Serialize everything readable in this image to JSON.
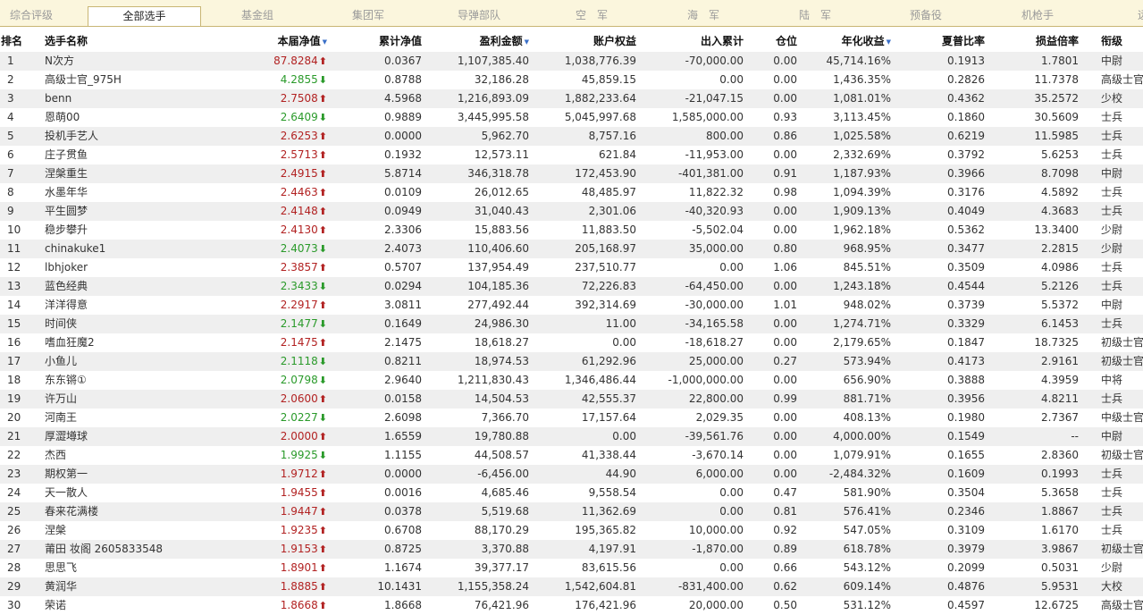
{
  "tabs": [
    {
      "label": "综合评级",
      "active": false
    },
    {
      "label": "全部选手",
      "active": true
    },
    {
      "label": "基金组",
      "active": false
    },
    {
      "label": "集团军",
      "active": false
    },
    {
      "label": "导弹部队",
      "active": false
    },
    {
      "label": "空　军",
      "active": false
    },
    {
      "label": "海　军",
      "active": false
    },
    {
      "label": "陆　军",
      "active": false
    },
    {
      "label": "预备役",
      "active": false
    },
    {
      "label": "机枪手",
      "active": false
    },
    {
      "label": "远",
      "active": false
    }
  ],
  "columns": {
    "rank": "排名",
    "name": "选手名称",
    "net": "本届净值",
    "cum_net": "累计净值",
    "pl": "盈利金额",
    "equity": "账户权益",
    "inout": "出入累计",
    "position": "仓位",
    "annual": "年化收益",
    "sharpe": "夏普比率",
    "profit_ratio": "损益倍率",
    "military_rank": "衔级"
  },
  "sorted_columns": [
    "net",
    "pl",
    "annual"
  ],
  "colors": {
    "up": "#b22222",
    "down": "#2a9a2a",
    "accent": "#c8b674",
    "tab_bg": "#fbf6dd",
    "row_alt": "#efefef"
  },
  "icons": {
    "up": "arrow-up-icon",
    "down": "arrow-down-icon",
    "sort": "sort-desc-icon"
  },
  "rows": [
    {
      "rank": "1",
      "name": "N次方",
      "net": "87.8284",
      "dir": "up",
      "cum": "0.0367",
      "pl": "1,107,385.40",
      "eq": "1,038,776.39",
      "io": "-70,000.00",
      "pos": "0.00",
      "ann": "45,714.16%",
      "sh": "0.1913",
      "pr": "1.7801",
      "rk": "中尉"
    },
    {
      "rank": "2",
      "name": "高级士官_975H",
      "net": "4.2855",
      "dir": "down",
      "cum": "0.8788",
      "pl": "32,186.28",
      "eq": "45,859.15",
      "io": "0.00",
      "pos": "0.00",
      "ann": "1,436.35%",
      "sh": "0.2826",
      "pr": "11.7378",
      "rk": "高级士官"
    },
    {
      "rank": "3",
      "name": "benn",
      "net": "2.7508",
      "dir": "up",
      "cum": "4.5968",
      "pl": "1,216,893.09",
      "eq": "1,882,233.64",
      "io": "-21,047.15",
      "pos": "0.00",
      "ann": "1,081.01%",
      "sh": "0.4362",
      "pr": "35.2572",
      "rk": "少校"
    },
    {
      "rank": "4",
      "name": "恩萌00",
      "net": "2.6409",
      "dir": "down",
      "cum": "0.9889",
      "pl": "3,445,995.58",
      "eq": "5,045,997.68",
      "io": "1,585,000.00",
      "pos": "0.93",
      "ann": "3,113.45%",
      "sh": "0.1860",
      "pr": "30.5609",
      "rk": "士兵"
    },
    {
      "rank": "5",
      "name": "投机手艺人",
      "net": "2.6253",
      "dir": "up",
      "cum": "0.0000",
      "pl": "5,962.70",
      "eq": "8,757.16",
      "io": "800.00",
      "pos": "0.86",
      "ann": "1,025.58%",
      "sh": "0.6219",
      "pr": "11.5985",
      "rk": "士兵"
    },
    {
      "rank": "6",
      "name": "庄子贯鱼",
      "net": "2.5713",
      "dir": "up",
      "cum": "0.1932",
      "pl": "12,573.11",
      "eq": "621.84",
      "io": "-11,953.00",
      "pos": "0.00",
      "ann": "2,332.69%",
      "sh": "0.3792",
      "pr": "5.6253",
      "rk": "士兵"
    },
    {
      "rank": "7",
      "name": "涅槃重生",
      "net": "2.4915",
      "dir": "up",
      "cum": "5.8714",
      "pl": "346,318.78",
      "eq": "172,453.90",
      "io": "-401,381.00",
      "pos": "0.91",
      "ann": "1,187.93%",
      "sh": "0.3966",
      "pr": "8.7098",
      "rk": "中尉"
    },
    {
      "rank": "8",
      "name": "水墨年华",
      "net": "2.4463",
      "dir": "up",
      "cum": "0.0109",
      "pl": "26,012.65",
      "eq": "48,485.97",
      "io": "11,822.32",
      "pos": "0.98",
      "ann": "1,094.39%",
      "sh": "0.3176",
      "pr": "4.5892",
      "rk": "士兵"
    },
    {
      "rank": "9",
      "name": "平生圆梦",
      "net": "2.4148",
      "dir": "up",
      "cum": "0.0949",
      "pl": "31,040.43",
      "eq": "2,301.06",
      "io": "-40,320.93",
      "pos": "0.00",
      "ann": "1,909.13%",
      "sh": "0.4049",
      "pr": "4.3683",
      "rk": "士兵"
    },
    {
      "rank": "10",
      "name": "稳步攀升",
      "net": "2.4130",
      "dir": "up",
      "cum": "2.3306",
      "pl": "15,883.56",
      "eq": "11,883.50",
      "io": "-5,502.04",
      "pos": "0.00",
      "ann": "1,962.18%",
      "sh": "0.5362",
      "pr": "13.3400",
      "rk": "少尉"
    },
    {
      "rank": "11",
      "name": "chinakuke1",
      "net": "2.4073",
      "dir": "down",
      "cum": "2.4073",
      "pl": "110,406.60",
      "eq": "205,168.97",
      "io": "35,000.00",
      "pos": "0.80",
      "ann": "968.95%",
      "sh": "0.3477",
      "pr": "2.2815",
      "rk": "少尉"
    },
    {
      "rank": "12",
      "name": "lbhjoker",
      "net": "2.3857",
      "dir": "up",
      "cum": "0.5707",
      "pl": "137,954.49",
      "eq": "237,510.77",
      "io": "0.00",
      "pos": "1.06",
      "ann": "845.51%",
      "sh": "0.3509",
      "pr": "4.0986",
      "rk": "士兵"
    },
    {
      "rank": "13",
      "name": "蓝色经典",
      "net": "2.3433",
      "dir": "down",
      "cum": "0.0294",
      "pl": "104,185.36",
      "eq": "72,226.83",
      "io": "-64,450.00",
      "pos": "0.00",
      "ann": "1,243.18%",
      "sh": "0.4544",
      "pr": "5.2126",
      "rk": "士兵"
    },
    {
      "rank": "14",
      "name": "洋洋得意",
      "net": "2.2917",
      "dir": "up",
      "cum": "3.0811",
      "pl": "277,492.44",
      "eq": "392,314.69",
      "io": "-30,000.00",
      "pos": "1.01",
      "ann": "948.02%",
      "sh": "0.3739",
      "pr": "5.5372",
      "rk": "中尉"
    },
    {
      "rank": "15",
      "name": "时间侠",
      "net": "2.1477",
      "dir": "down",
      "cum": "0.1649",
      "pl": "24,986.30",
      "eq": "11.00",
      "io": "-34,165.58",
      "pos": "0.00",
      "ann": "1,274.71%",
      "sh": "0.3329",
      "pr": "6.1453",
      "rk": "士兵"
    },
    {
      "rank": "16",
      "name": "嗜血狂魔2",
      "net": "2.1475",
      "dir": "up",
      "cum": "2.1475",
      "pl": "18,618.27",
      "eq": "0.00",
      "io": "-18,618.27",
      "pos": "0.00",
      "ann": "2,179.65%",
      "sh": "0.1847",
      "pr": "18.7325",
      "rk": "初级士官"
    },
    {
      "rank": "17",
      "name": "小鱼儿",
      "net": "2.1118",
      "dir": "down",
      "cum": "0.8211",
      "pl": "18,974.53",
      "eq": "61,292.96",
      "io": "25,000.00",
      "pos": "0.27",
      "ann": "573.94%",
      "sh": "0.4173",
      "pr": "2.9161",
      "rk": "初级士官"
    },
    {
      "rank": "18",
      "name": "东东锵①",
      "net": "2.0798",
      "dir": "down",
      "cum": "2.9640",
      "pl": "1,211,830.43",
      "eq": "1,346,486.44",
      "io": "-1,000,000.00",
      "pos": "0.00",
      "ann": "656.90%",
      "sh": "0.3888",
      "pr": "4.3959",
      "rk": "中将"
    },
    {
      "rank": "19",
      "name": "许万山",
      "net": "2.0600",
      "dir": "up",
      "cum": "0.0158",
      "pl": "14,504.53",
      "eq": "42,555.37",
      "io": "22,800.00",
      "pos": "0.99",
      "ann": "881.71%",
      "sh": "0.3956",
      "pr": "4.8211",
      "rk": "士兵"
    },
    {
      "rank": "20",
      "name": "河南王",
      "net": "2.0227",
      "dir": "down",
      "cum": "2.6098",
      "pl": "7,366.70",
      "eq": "17,157.64",
      "io": "2,029.35",
      "pos": "0.00",
      "ann": "408.13%",
      "sh": "0.1980",
      "pr": "2.7367",
      "rk": "中级士官"
    },
    {
      "rank": "21",
      "name": "厚澀墫球",
      "net": "2.0000",
      "dir": "up",
      "cum": "1.6559",
      "pl": "19,780.88",
      "eq": "0.00",
      "io": "-39,561.76",
      "pos": "0.00",
      "ann": "4,000.00%",
      "sh": "0.1549",
      "pr": "--",
      "rk": "中尉"
    },
    {
      "rank": "22",
      "name": "杰西",
      "net": "1.9925",
      "dir": "down",
      "cum": "1.1155",
      "pl": "44,508.57",
      "eq": "41,338.44",
      "io": "-3,670.14",
      "pos": "0.00",
      "ann": "1,079.91%",
      "sh": "0.1655",
      "pr": "2.8360",
      "rk": "初级士官"
    },
    {
      "rank": "23",
      "name": "期权第一",
      "net": "1.9712",
      "dir": "up",
      "cum": "0.0000",
      "pl": "-6,456.00",
      "eq": "44.90",
      "io": "6,000.00",
      "pos": "0.00",
      "ann": "-2,484.32%",
      "sh": "0.1609",
      "pr": "0.1993",
      "rk": "士兵"
    },
    {
      "rank": "24",
      "name": "天一散人",
      "net": "1.9455",
      "dir": "up",
      "cum": "0.0016",
      "pl": "4,685.46",
      "eq": "9,558.54",
      "io": "0.00",
      "pos": "0.47",
      "ann": "581.90%",
      "sh": "0.3504",
      "pr": "5.3658",
      "rk": "士兵"
    },
    {
      "rank": "25",
      "name": "春来花满楼",
      "net": "1.9447",
      "dir": "up",
      "cum": "0.0378",
      "pl": "5,519.68",
      "eq": "11,362.69",
      "io": "0.00",
      "pos": "0.81",
      "ann": "576.41%",
      "sh": "0.2346",
      "pr": "1.8867",
      "rk": "士兵"
    },
    {
      "rank": "26",
      "name": "涅槃",
      "net": "1.9235",
      "dir": "up",
      "cum": "0.6708",
      "pl": "88,170.29",
      "eq": "195,365.82",
      "io": "10,000.00",
      "pos": "0.92",
      "ann": "547.05%",
      "sh": "0.3109",
      "pr": "1.6170",
      "rk": "士兵"
    },
    {
      "rank": "27",
      "name": "莆田 妆阁 2605833548",
      "net": "1.9153",
      "dir": "up",
      "cum": "0.8725",
      "pl": "3,370.88",
      "eq": "4,197.91",
      "io": "-1,870.00",
      "pos": "0.89",
      "ann": "618.78%",
      "sh": "0.3979",
      "pr": "3.9867",
      "rk": "初级士官"
    },
    {
      "rank": "28",
      "name": "思思飞",
      "net": "1.8901",
      "dir": "up",
      "cum": "1.1674",
      "pl": "39,377.17",
      "eq": "83,615.56",
      "io": "0.00",
      "pos": "0.66",
      "ann": "543.12%",
      "sh": "0.2099",
      "pr": "0.5031",
      "rk": "少尉"
    },
    {
      "rank": "29",
      "name": "黄润华",
      "net": "1.8885",
      "dir": "up",
      "cum": "10.1431",
      "pl": "1,155,358.24",
      "eq": "1,542,604.81",
      "io": "-831,400.00",
      "pos": "0.62",
      "ann": "609.14%",
      "sh": "0.4876",
      "pr": "5.9531",
      "rk": "大校"
    },
    {
      "rank": "30",
      "name": "荣诺",
      "net": "1.8668",
      "dir": "up",
      "cum": "1.8668",
      "pl": "76,421.96",
      "eq": "176,421.96",
      "io": "20,000.00",
      "pos": "0.50",
      "ann": "531.12%",
      "sh": "0.4597",
      "pr": "12.6725",
      "rk": "高级士官"
    }
  ]
}
